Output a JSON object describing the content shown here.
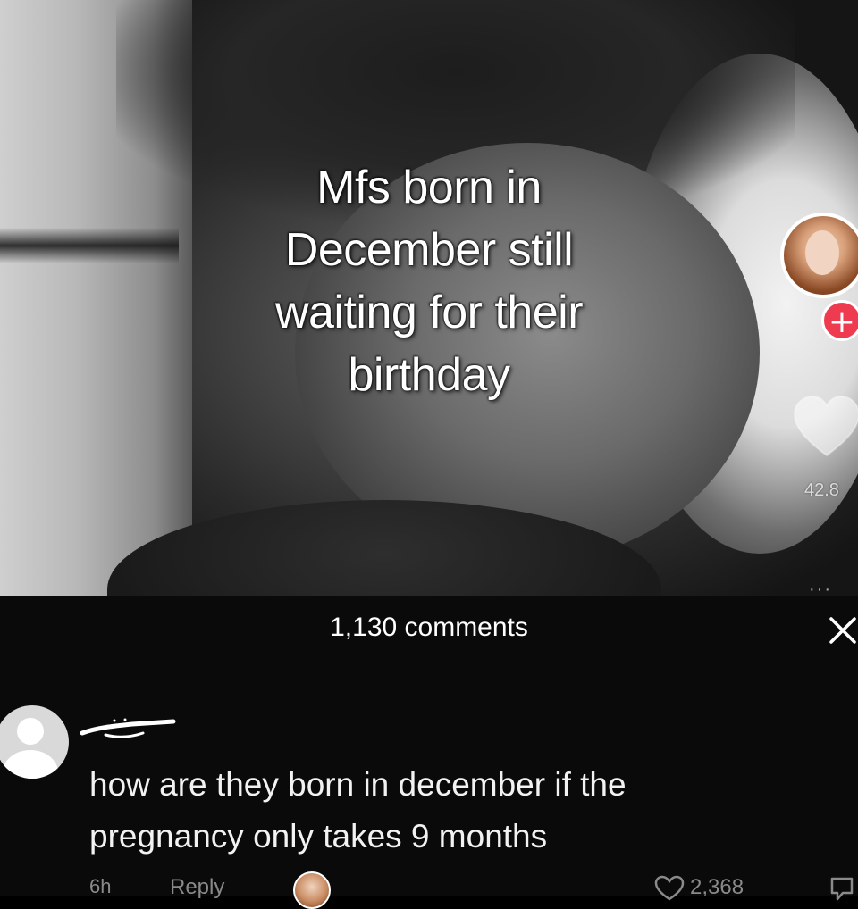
{
  "video": {
    "caption_lines": [
      "Mfs born in",
      "December still",
      "waiting for their",
      "birthday"
    ],
    "like_count": "42.8",
    "follow_symbol": "+",
    "more_symbol": "···"
  },
  "comments_panel": {
    "title": "1,130 comments",
    "close_symbol": "✕",
    "comment": {
      "text_lines": [
        "how are they born in december if the",
        "pregnancy only takes 9 months"
      ],
      "time": "6h",
      "reply_label": "Reply",
      "like_count": "2,368"
    }
  },
  "colors": {
    "follow_accent": "#ef3b4f",
    "panel_background": "#0a0a0a",
    "muted_text": "#8a8a8a"
  },
  "icons": [
    "heart-icon",
    "close-icon",
    "plus-icon",
    "comment-like-icon",
    "dislike-icon",
    "default-avatar-icon"
  ]
}
